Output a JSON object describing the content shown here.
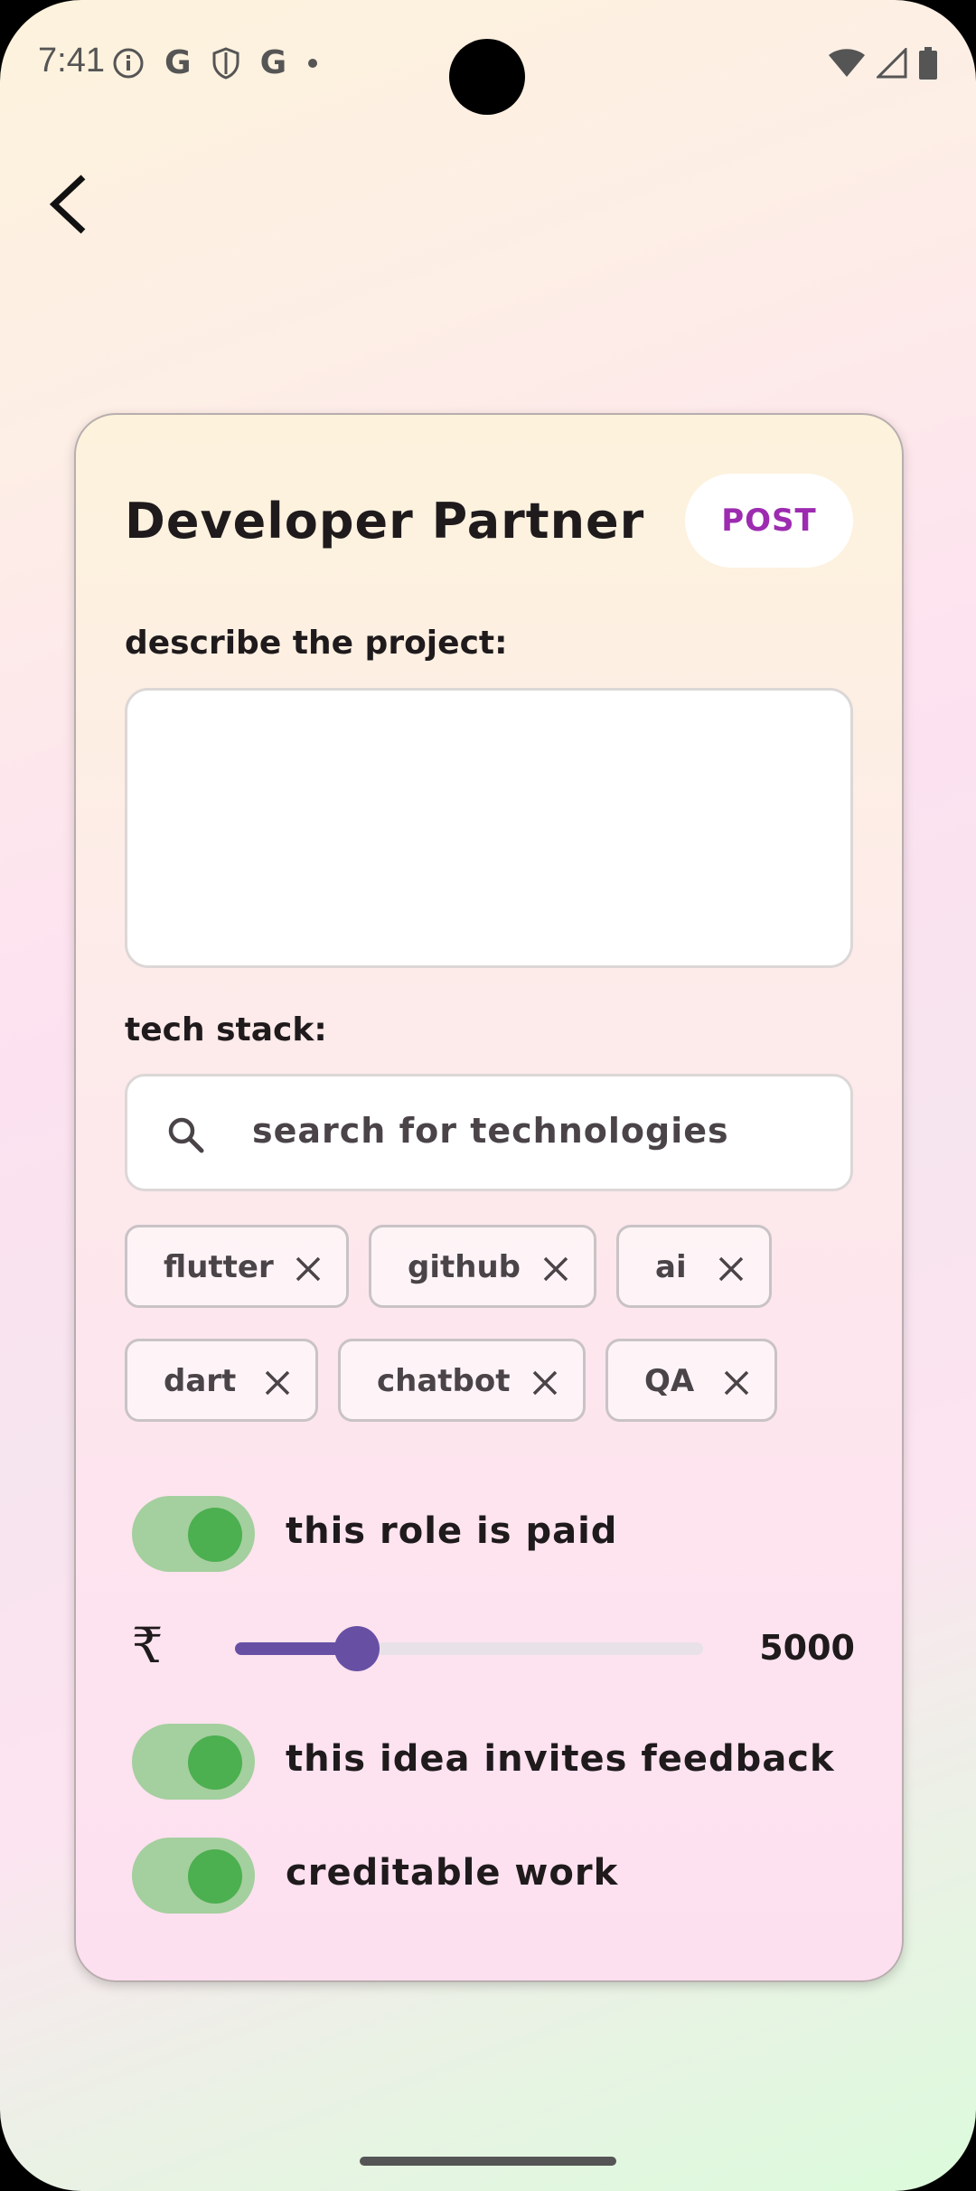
{
  "status_bar": {
    "time": "7:41",
    "left_icons": [
      "info-icon",
      "google-icon",
      "shield-icon",
      "google-icon",
      "dot-icon"
    ],
    "right_icons": [
      "wifi-icon",
      "signal-icon",
      "battery-icon"
    ]
  },
  "nav": {
    "back_icon": "chevron-left-icon"
  },
  "card": {
    "title": "Developer Partner",
    "post_label": "POST",
    "description_label": "describe the project:",
    "description_value": "",
    "tech_stack_label": "tech stack:",
    "search_placeholder": "search for technologies",
    "chips": [
      "flutter",
      "github",
      "ai",
      "dart",
      "chatbot",
      "QA"
    ],
    "toggles": [
      {
        "label": "this role is paid",
        "on": true
      },
      {
        "label": "this idea invites feedback",
        "on": true
      },
      {
        "label": "creditable work",
        "on": true
      }
    ],
    "currency_symbol": "₹",
    "amount": "5000",
    "slider_fraction": 0.26
  },
  "colors": {
    "accent": "#6750a4",
    "post_text": "#9c2bb0",
    "toggle_on": "#4caf50",
    "toggle_track": "#a4cf9e"
  }
}
